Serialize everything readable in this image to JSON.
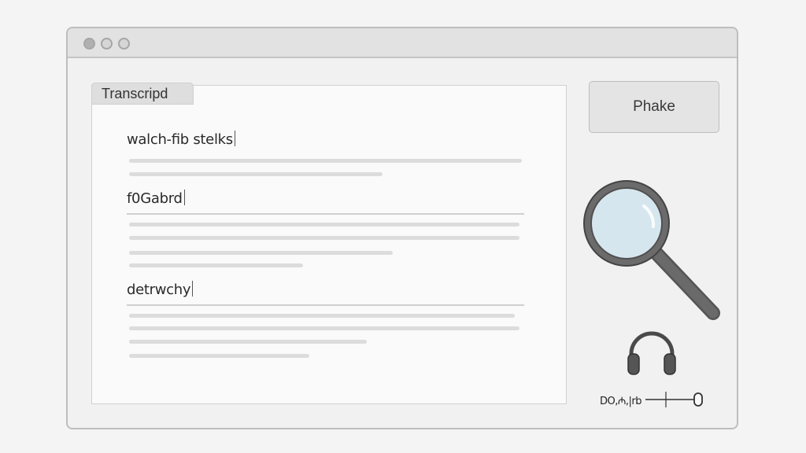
{
  "window": {
    "controls": [
      "close",
      "minimize",
      "maximize"
    ]
  },
  "transcript": {
    "tab_label": "Transcripd",
    "sections": [
      {
        "heading": "walch-ﬁb stelks",
        "line_fractions": [
          1.0,
          0.64
        ]
      },
      {
        "heading": "f0Gabrd",
        "line_fractions": [
          0.99,
          0.99,
          0.67,
          0.44
        ]
      },
      {
        "heading": "detrwchy",
        "line_fractions": [
          0.94,
          0.99,
          0.6,
          0.46
        ]
      }
    ]
  },
  "sidebar": {
    "button_label": "Phake",
    "search_icon": "magnifier-icon",
    "audio_icon": "headphones-icon"
  },
  "player": {
    "time": "DO,₼,|rb"
  },
  "colors": {
    "frame": "#bdbdbd",
    "icon": "#555555",
    "lens": "#d6e6ee"
  }
}
